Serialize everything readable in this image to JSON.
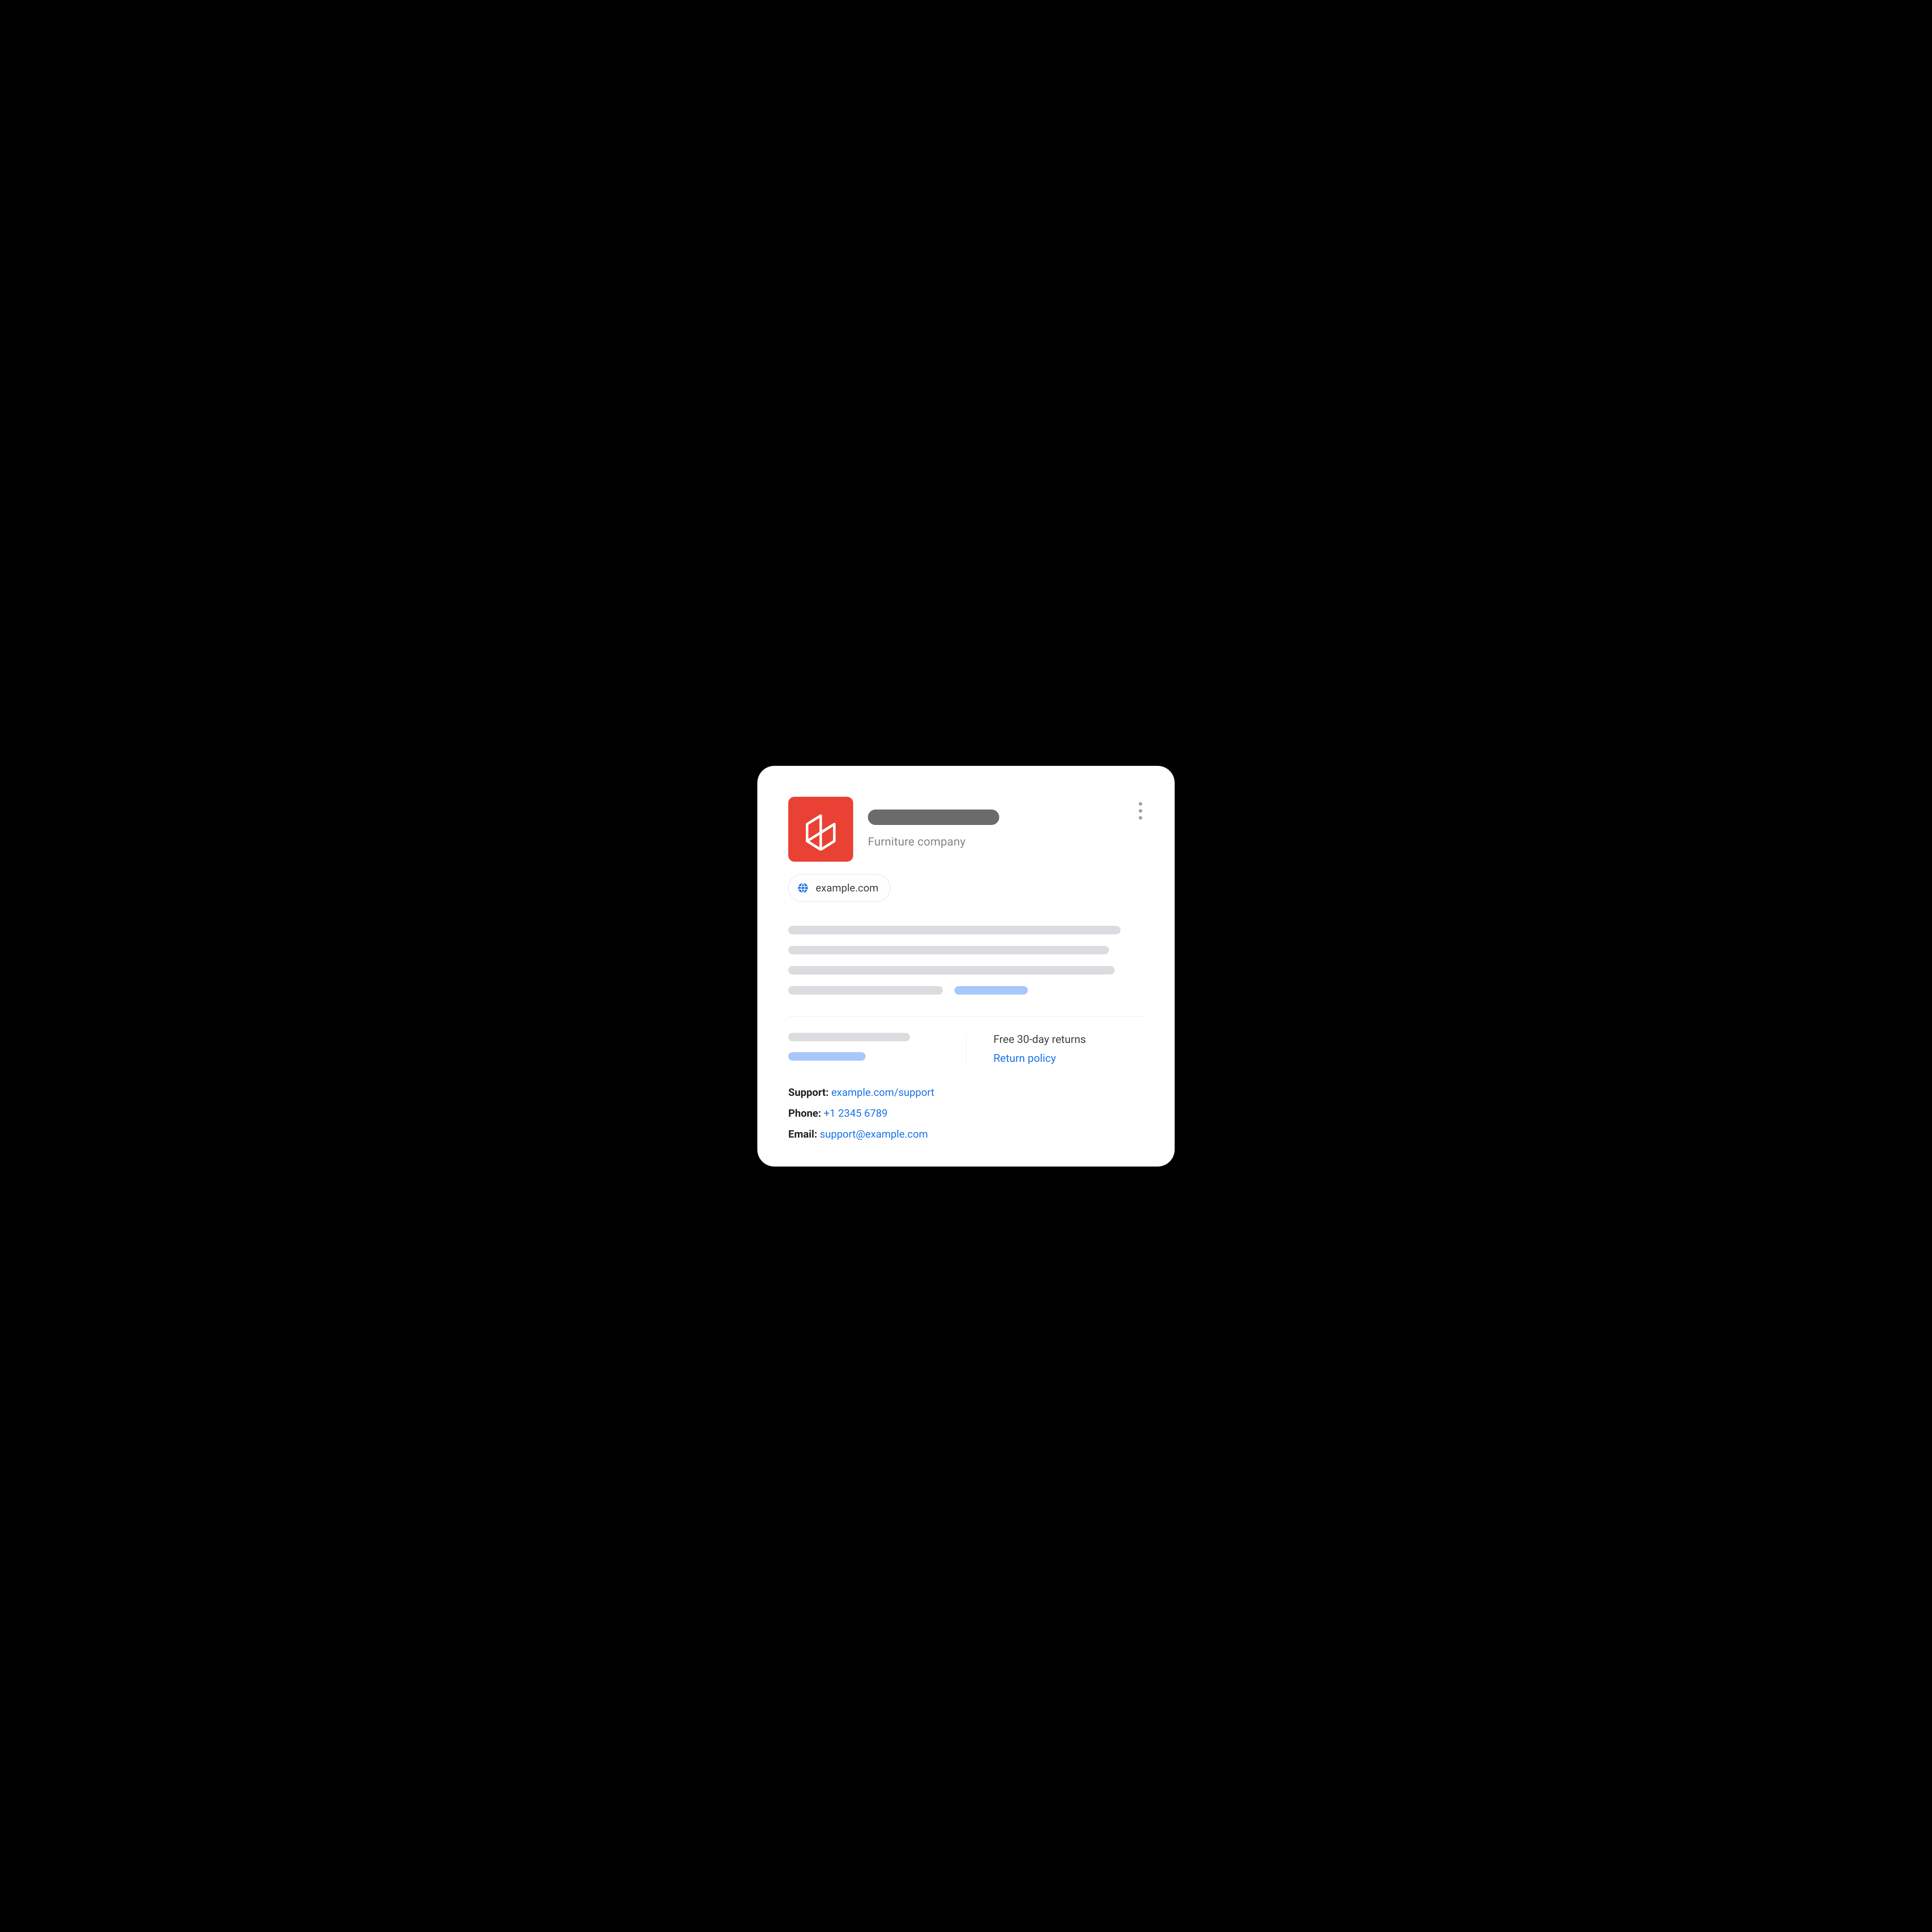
{
  "header": {
    "subtitle": "Furniture company",
    "website_chip": "example.com"
  },
  "returns": {
    "headline": "Free 30-day returns",
    "policy_link_label": "Return policy"
  },
  "contacts": {
    "support_label": "Support:",
    "support_value": "example.com/support",
    "phone_label": "Phone:",
    "phone_value": "+1 2345 6789",
    "email_label": "Email:",
    "email_value": "support@example.com"
  },
  "colors": {
    "logo_bg": "#e94235",
    "link": "#1a73e8",
    "skeleton_gray": "#dadce0",
    "skeleton_blue": "#a8c7fa",
    "title_skeleton": "#6b6b6b"
  }
}
